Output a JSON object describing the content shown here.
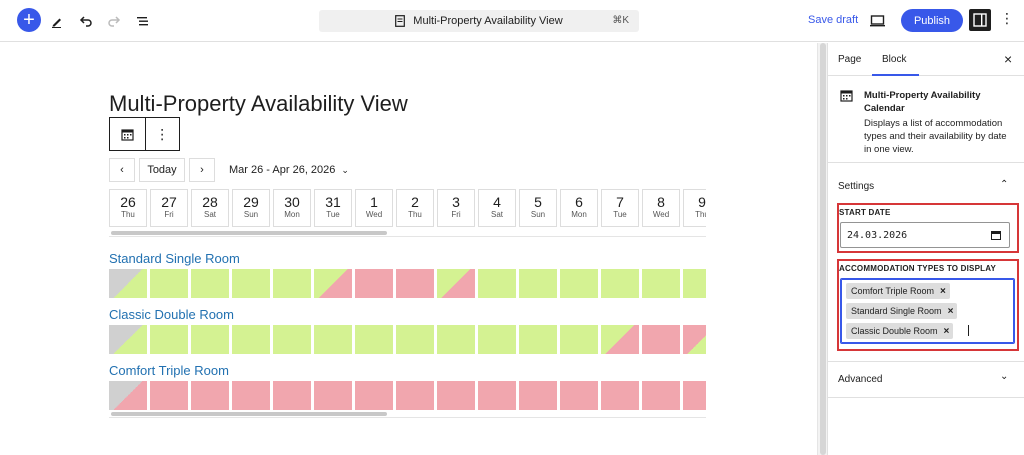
{
  "topbar": {
    "document_title": "Multi-Property Availability View",
    "shortcut": "⌘K",
    "save_draft": "Save draft",
    "publish": "Publish"
  },
  "editor": {
    "post_title": "Multi-Property Availability View"
  },
  "calendar": {
    "today_label": "Today",
    "range_label": "Mar 26 - Apr 26, 2026",
    "days": [
      {
        "num": "26",
        "dow": "Thu"
      },
      {
        "num": "27",
        "dow": "Fri"
      },
      {
        "num": "28",
        "dow": "Sat"
      },
      {
        "num": "29",
        "dow": "Sun"
      },
      {
        "num": "30",
        "dow": "Mon"
      },
      {
        "num": "31",
        "dow": "Tue"
      },
      {
        "num": "1",
        "dow": "Wed"
      },
      {
        "num": "2",
        "dow": "Thu"
      },
      {
        "num": "3",
        "dow": "Fri"
      },
      {
        "num": "4",
        "dow": "Sat"
      },
      {
        "num": "5",
        "dow": "Sun"
      },
      {
        "num": "6",
        "dow": "Mon"
      },
      {
        "num": "7",
        "dow": "Tue"
      },
      {
        "num": "8",
        "dow": "Wed"
      },
      {
        "num": "9",
        "dow": "Thu"
      }
    ],
    "rooms": [
      {
        "name": "Standard Single Room",
        "cells": [
          "na-av",
          "av",
          "av",
          "av",
          "av",
          "av-bk",
          "bk",
          "bk",
          "av-bk",
          "av",
          "av",
          "av",
          "av",
          "av",
          "av"
        ]
      },
      {
        "name": "Classic Double Room",
        "cells": [
          "na-av",
          "av",
          "av",
          "av",
          "av",
          "av",
          "av",
          "av",
          "av",
          "av",
          "av",
          "av",
          "av-bk",
          "bk",
          "bk-av"
        ]
      },
      {
        "name": "Comfort Triple Room",
        "cells": [
          "na-bk",
          "bk",
          "bk",
          "bk",
          "bk",
          "bk",
          "bk",
          "bk",
          "bk",
          "bk",
          "bk",
          "bk",
          "bk",
          "bk",
          "bk"
        ]
      }
    ],
    "colors": {
      "available": "#d4f292",
      "booked": "#f1a6ae",
      "past": "#d0d0d0"
    }
  },
  "sidebar": {
    "tabs": [
      "Page",
      "Block"
    ],
    "active_tab": "Block",
    "block_name": "Multi-Property Availability Calendar",
    "block_description": "Displays a list of accommodation types and their availability by date in one view.",
    "settings_title": "Settings",
    "start_date_label": "START DATE",
    "start_date_value": "24.03.2026",
    "accommodation_label": "ACCOMMODATION TYPES TO DISPLAY",
    "accommodation_tokens": [
      "Comfort Triple Room",
      "Standard Single Room",
      "Classic Double Room"
    ],
    "advanced_title": "Advanced",
    "accent_color": "#3858e9"
  }
}
